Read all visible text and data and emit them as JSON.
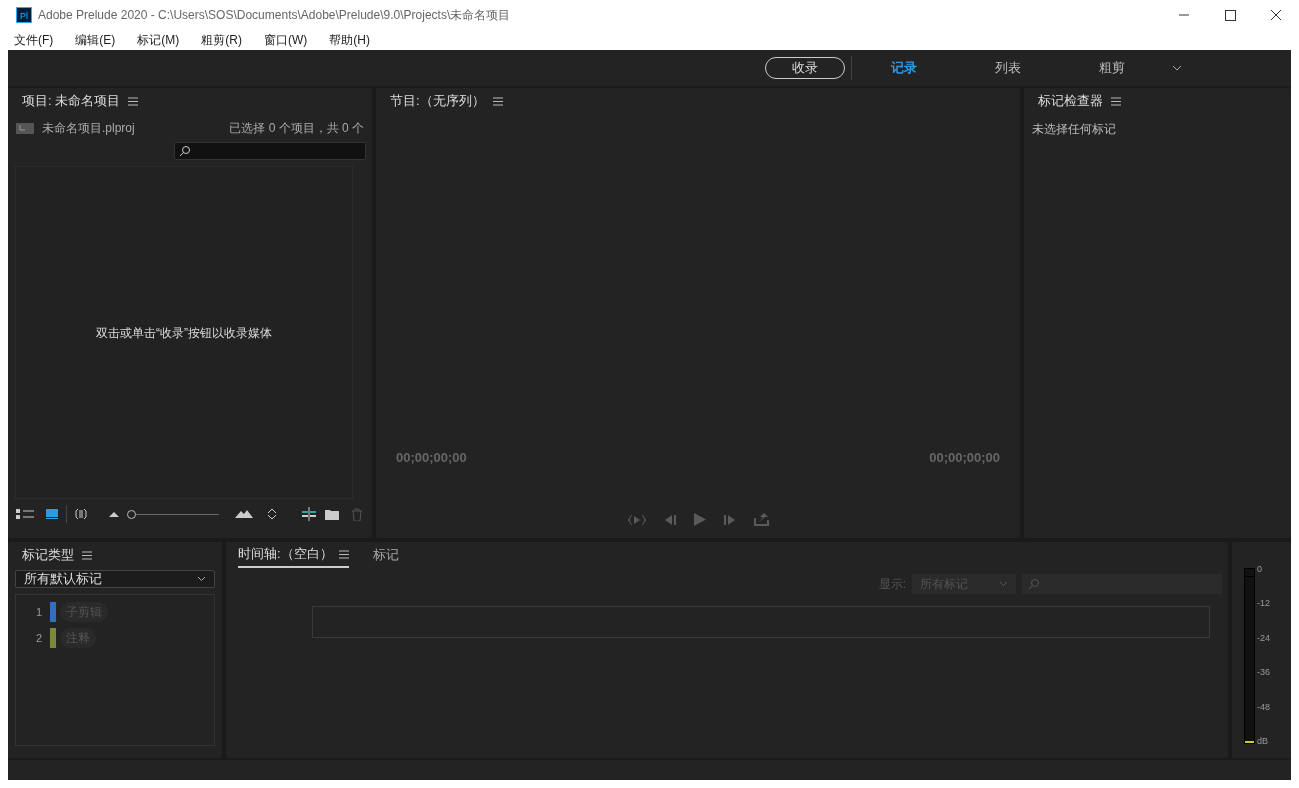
{
  "window": {
    "title": "Adobe Prelude 2020 - C:\\Users\\SOS\\Documents\\Adobe\\Prelude\\9.0\\Projects\\未命名项目",
    "app_badge": "Pl"
  },
  "menu": [
    "文件(F)",
    "编辑(E)",
    "标记(M)",
    "粗剪(R)",
    "窗口(W)",
    "帮助(H)"
  ],
  "workspace": {
    "ingest_button": "收录",
    "tabs": [
      {
        "label": "记录",
        "selected": true
      },
      {
        "label": "列表",
        "selected": false
      },
      {
        "label": "粗剪",
        "selected": false
      }
    ]
  },
  "project_panel": {
    "title": "项目: 未命名项目",
    "file": "未命名项目.plproj",
    "selection_info": "已选择 0 个项目，共 0 个",
    "empty_message": "双击或单击“收录”按钮以收录媒体",
    "zoom": {
      "level": 0
    }
  },
  "program_panel": {
    "title": "节目:（无序列）",
    "timecode_left": "00;00;00;00",
    "timecode_right": "00;00;00;00"
  },
  "inspector_panel": {
    "title": "标记检查器",
    "message": "未选择任何标记"
  },
  "marker_types_panel": {
    "title": "标记类型",
    "filter": "所有默认标记",
    "items": [
      {
        "number": "1",
        "label": "子剪辑",
        "color": "#2f6fc4"
      },
      {
        "number": "2",
        "label": "注释",
        "color": "#7a8a35"
      }
    ]
  },
  "timeline_panel": {
    "tabs": [
      {
        "label": "时间轴:（空白）",
        "selected": true
      },
      {
        "label": "标记",
        "selected": false
      }
    ],
    "show_label": "显示:",
    "show_value": "所有标记"
  },
  "audio_meter": {
    "ticks": [
      "0",
      "-12",
      "-24",
      "-36",
      "-48",
      "dB"
    ]
  }
}
